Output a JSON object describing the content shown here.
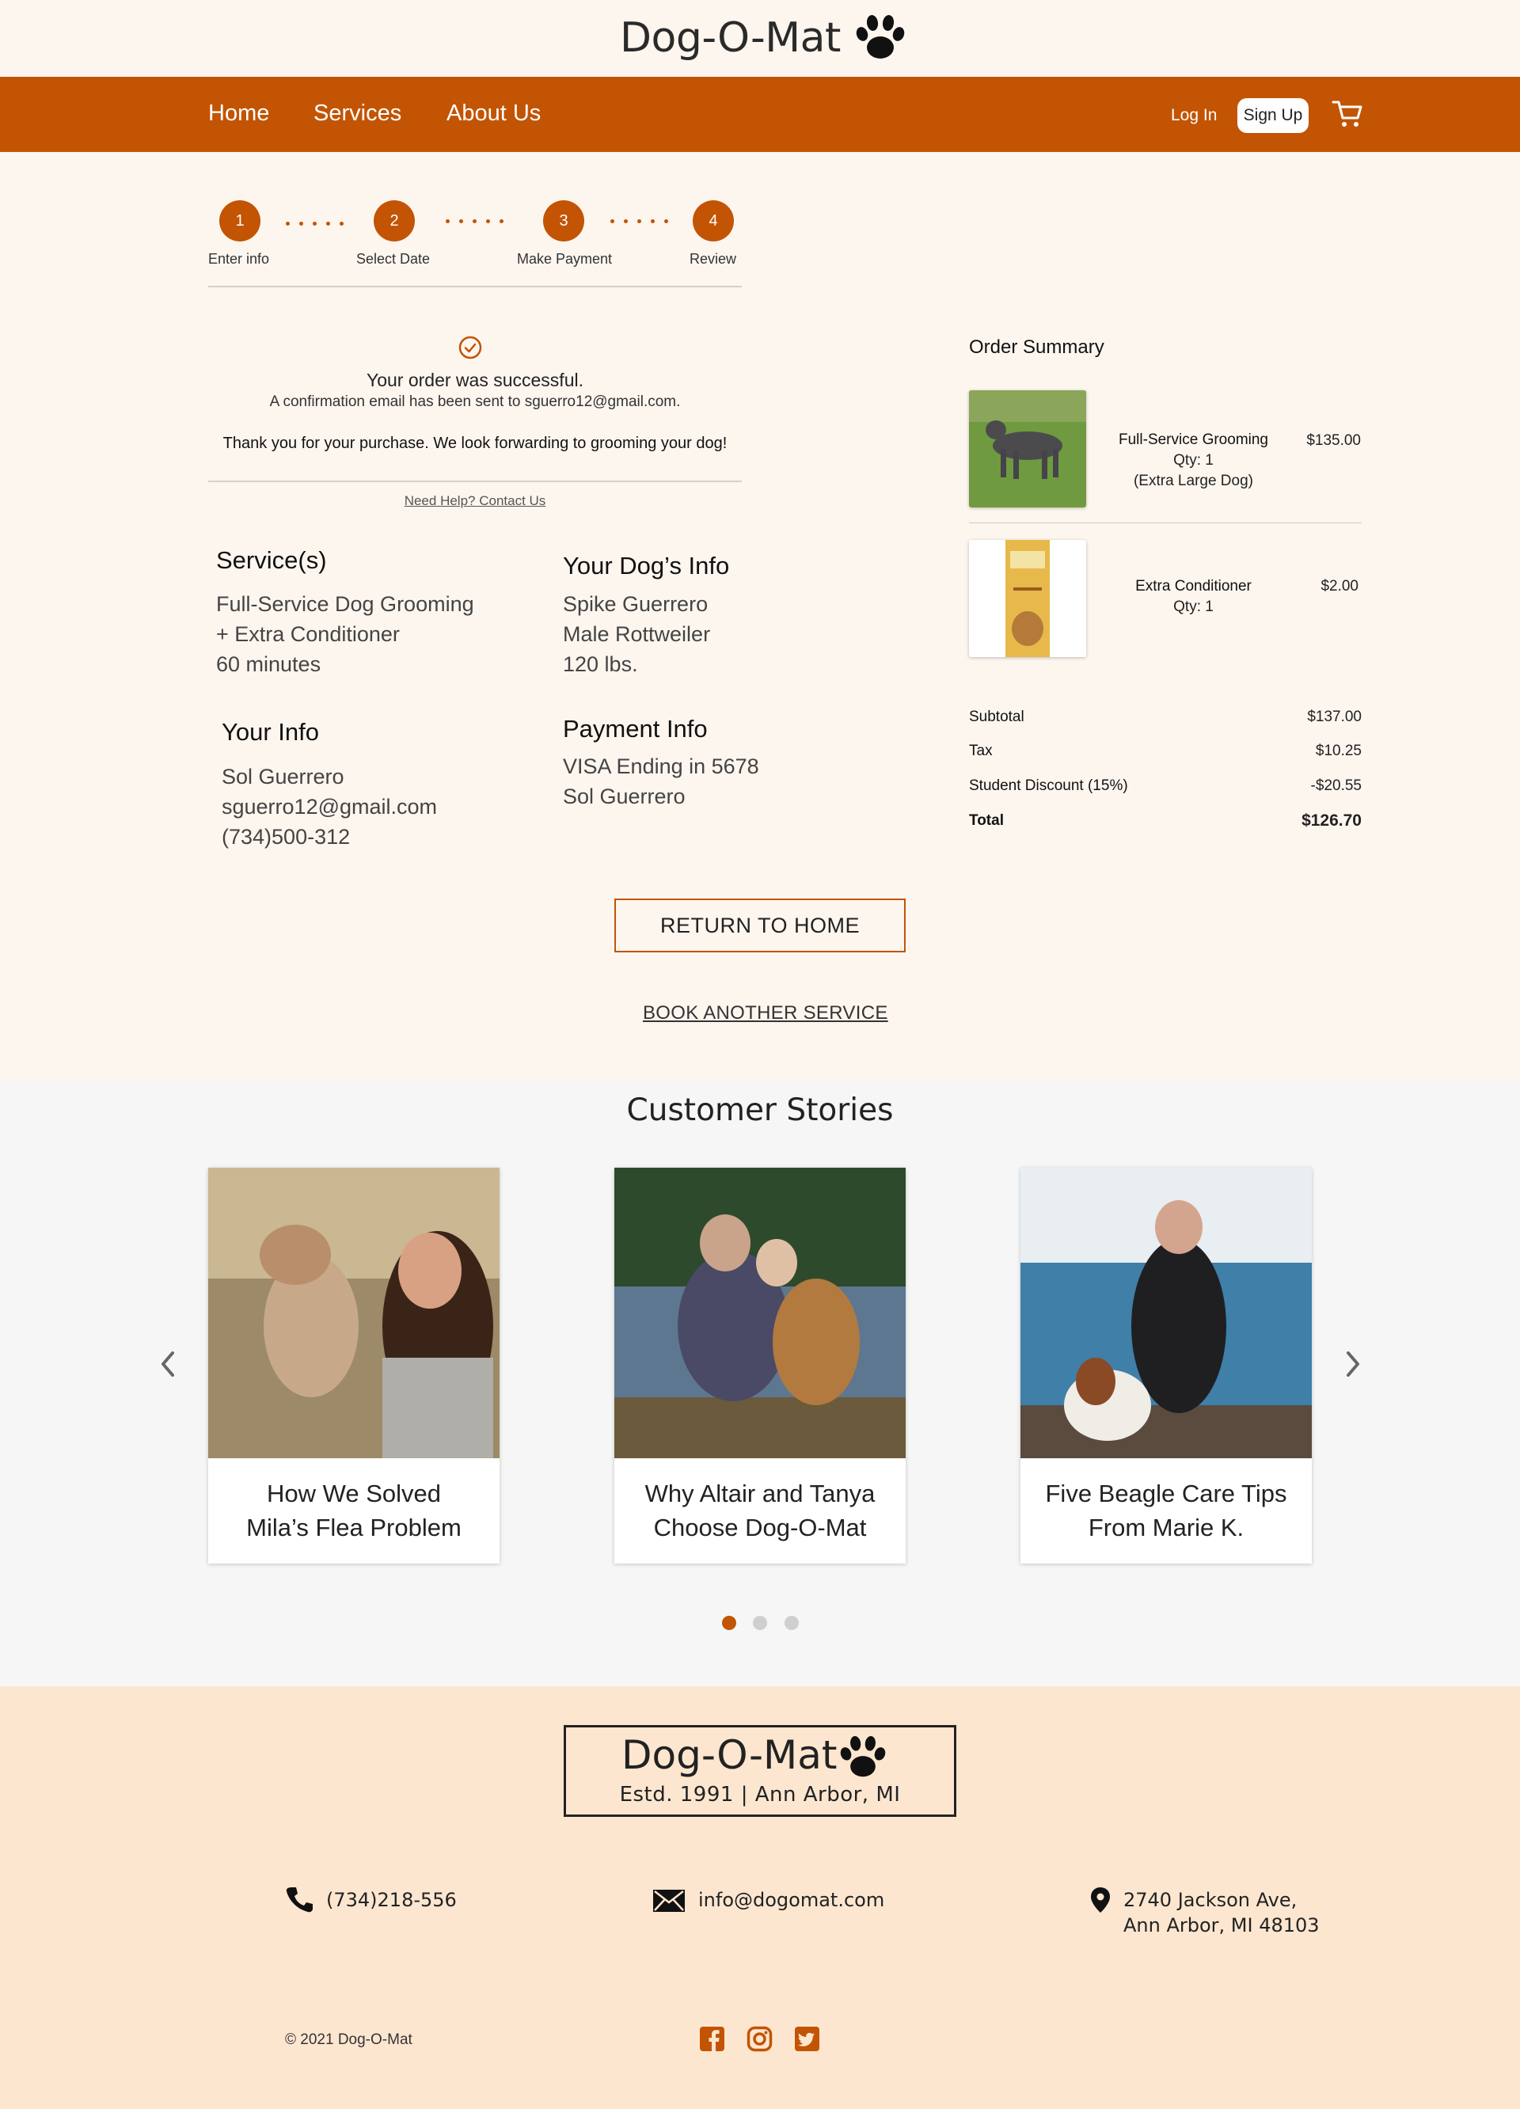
{
  "brand": {
    "name": "Dog-O-Mat",
    "paw_icon": "paw-icon"
  },
  "nav": {
    "links": [
      "Home",
      "Services",
      "About Us"
    ],
    "login": "Log In",
    "signup": "Sign Up",
    "cart_icon": "cart-icon"
  },
  "stepper": {
    "steps": [
      {
        "num": "1",
        "label": "Enter info"
      },
      {
        "num": "2",
        "label": "Select Date"
      },
      {
        "num": "3",
        "label": "Make Payment"
      },
      {
        "num": "4",
        "label": "Review"
      }
    ]
  },
  "confirmation": {
    "title": "Your order was successful.",
    "email_note": "A confirmation email has been sent to sguerro12@gmail.com.",
    "thanks": "Thank you for your purchase. We look forwarding to grooming your dog!",
    "help_link": "Need Help? Contact Us"
  },
  "details": {
    "services": {
      "heading": "Service(s)",
      "lines": [
        "Full-Service Dog Grooming",
        "+ Extra Conditioner",
        "60 minutes"
      ]
    },
    "dog": {
      "heading": "Your Dog’s Info",
      "lines": [
        "Spike Guerrero",
        "Male Rottweiler",
        "120 lbs."
      ]
    },
    "you": {
      "heading": "Your Info",
      "lines": [
        "Sol Guerrero",
        "sguerro12@gmail.com",
        "(734)500-312"
      ]
    },
    "payment": {
      "heading": "Payment Info",
      "lines": [
        "VISA Ending in 5678",
        "Sol Guerrero"
      ]
    }
  },
  "order_summary": {
    "title": "Order Summary",
    "items": [
      {
        "name": "Full-Service Grooming",
        "qty": "Qty: 1",
        "note": "(Extra Large Dog)",
        "price": "$135.00"
      },
      {
        "name": "Extra Conditioner",
        "qty": "Qty: 1",
        "price": "$2.00"
      }
    ],
    "subtotal_label": "Subtotal",
    "subtotal": "$137.00",
    "tax_label": "Tax",
    "tax": "$10.25",
    "discount_label": "Student Discount (15%)",
    "discount": "-$20.55",
    "total_label": "Total",
    "total": "$126.70"
  },
  "actions": {
    "return_home": "RETURN TO HOME",
    "book_another": "BOOK ANOTHER SERVICE"
  },
  "stories": {
    "title": "Customer Stories",
    "cards": [
      {
        "line1": "How We Solved",
        "line2": "Mila’s Flea Problem"
      },
      {
        "line1": "Why Altair and Tanya",
        "line2": "Choose Dog-O-Mat"
      },
      {
        "line1": "Five Beagle Care Tips",
        "line2": "From Marie K."
      }
    ],
    "active_dot": 1
  },
  "footer": {
    "tagline": "Estd. 1991  |  Ann Arbor, MI",
    "phone": "(734)218-556",
    "email": "info@dogomat.com",
    "address_line1": "2740 Jackson Ave,",
    "address_line2": "Ann Arbor, MI 48103",
    "copyright": "© 2021 Dog-O-Mat"
  },
  "colors": {
    "accent": "#c25403",
    "page_bg": "#fdf6ef",
    "footer_bg": "#fde6d0",
    "stories_bg": "#f6f6f6"
  }
}
